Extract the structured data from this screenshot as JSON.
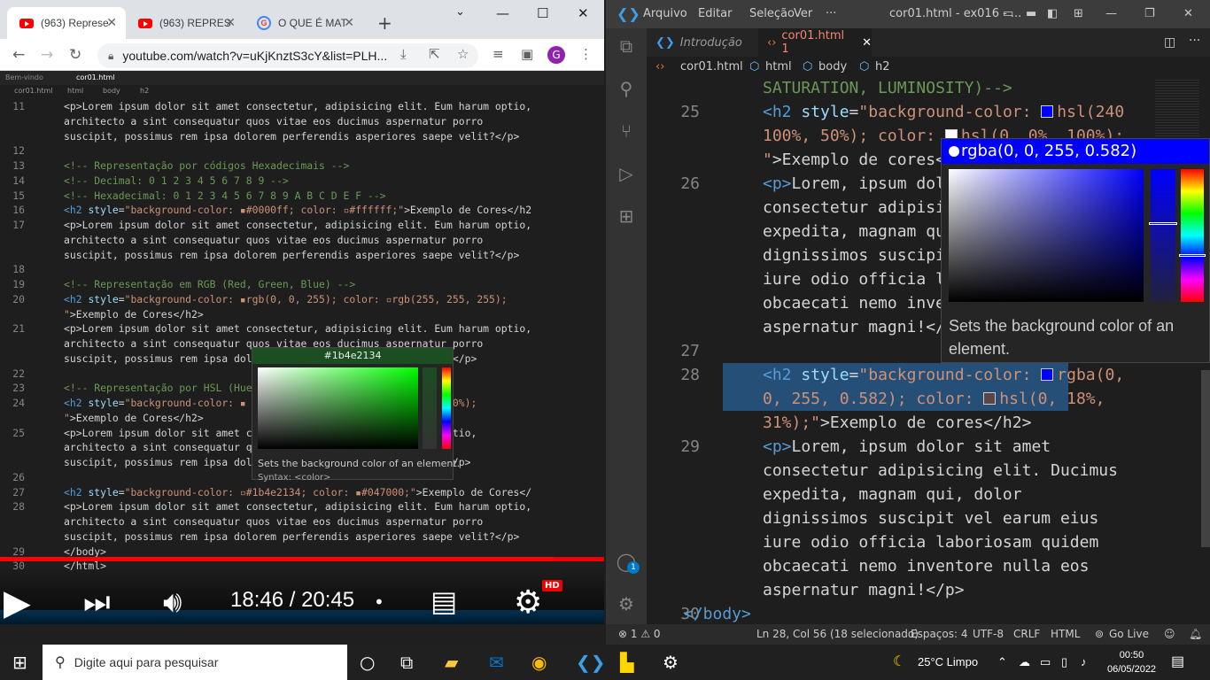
{
  "chrome": {
    "tabs": [
      {
        "label": "(963) Represe",
        "active": true
      },
      {
        "label": "(963) REPRES",
        "active": false
      },
      {
        "label": "O QUE É MAT",
        "active": false
      }
    ],
    "new_tab": "+",
    "url": "youtube.com/watch?v=uKjKnztS3cY&list=PLH...",
    "avatar": "G"
  },
  "video": {
    "inner_tabs": [
      "Bem-vindo",
      "cor01.html"
    ],
    "inner_crumbs": [
      "cor01.html",
      "html",
      "body",
      "h2"
    ],
    "lines": [
      {
        "n": "11",
        "parts": [
          [
            "tx",
            "<p>Lorem ipsum dolor sit amet consectetur, adipisicing elit. Eum harum optio,"
          ]
        ]
      },
      {
        "n": "",
        "parts": [
          [
            "tx",
            "architecto a sint consequatur quos vitae eos ducimus aspernatur porro"
          ]
        ]
      },
      {
        "n": "",
        "parts": [
          [
            "tx",
            "suscipit, possimus rem ipsa dolorem perferendis asperiores saepe velit?</p>"
          ]
        ]
      },
      {
        "n": "12",
        "parts": []
      },
      {
        "n": "13",
        "parts": [
          [
            "cm",
            "<!-- Representação por códigos Hexadecimais -->"
          ]
        ]
      },
      {
        "n": "14",
        "parts": [
          [
            "cm",
            "<!-- Decimal: 0 1 2 3 4 5 6 7 8 9 -->"
          ]
        ]
      },
      {
        "n": "15",
        "parts": [
          [
            "cm",
            "<!-- Hexadecimal: 0 1 2 3 4 5 6 7 8 9 A B C D E F -->"
          ]
        ]
      },
      {
        "n": "16",
        "parts": [
          [
            "tg",
            "<h2 "
          ],
          [
            "at",
            "style"
          ],
          [
            "tx",
            "="
          ],
          [
            "st",
            "\"background-color: ▪#0000ff; color: ▫#ffffff;\""
          ],
          [
            "tx",
            ">Exemplo de Cores</h2"
          ]
        ]
      },
      {
        "n": "17",
        "parts": [
          [
            "tx",
            "<p>Lorem ipsum dolor sit amet consectetur, adipisicing elit. Eum harum optio,"
          ]
        ]
      },
      {
        "n": "",
        "parts": [
          [
            "tx",
            "architecto a sint consequatur quos vitae eos ducimus aspernatur porro"
          ]
        ]
      },
      {
        "n": "",
        "parts": [
          [
            "tx",
            "suscipit, possimus rem ipsa dolorem perferendis asperiores saepe velit?</p>"
          ]
        ]
      },
      {
        "n": "18",
        "parts": []
      },
      {
        "n": "19",
        "parts": [
          [
            "cm",
            "<!-- Representação em RGB (Red, Green, Blue) -->"
          ]
        ]
      },
      {
        "n": "20",
        "parts": [
          [
            "tg",
            "<h2 "
          ],
          [
            "at",
            "style"
          ],
          [
            "tx",
            "="
          ],
          [
            "st",
            "\"background-color: ▪rgb(0, 0, 255); color: ▫rgb(255, 255, 255);"
          ]
        ]
      },
      {
        "n": "",
        "parts": [
          [
            "st",
            "\""
          ],
          [
            "tx",
            ">Exemplo de Cores</h2>"
          ]
        ]
      },
      {
        "n": "21",
        "parts": [
          [
            "tx",
            "<p>Lorem ipsum dolor sit amet consectetur, adipisicing elit. Eum harum optio,"
          ]
        ]
      },
      {
        "n": "",
        "parts": [
          [
            "tx",
            "architecto a sint consequatur quos vitae eos ducimus aspernatur porro"
          ]
        ]
      },
      {
        "n": "",
        "parts": [
          [
            "tx",
            "suscipit, possimus rem ipsa dolo                          velit?</p>"
          ]
        ]
      },
      {
        "n": "22",
        "parts": []
      },
      {
        "n": "23",
        "parts": [
          [
            "cm",
            "<!-- Representação por HSL (Hue"
          ]
        ]
      },
      {
        "n": "24",
        "parts": [
          [
            "tg",
            "<h2 "
          ],
          [
            "at",
            "style"
          ],
          [
            "tx",
            "="
          ],
          [
            "st",
            "\"background-color: ▪                         0, 0%, 100%);"
          ]
        ]
      },
      {
        "n": "",
        "parts": [
          [
            "st",
            "\""
          ],
          [
            "tx",
            ">Exemplo de Cores</h2>"
          ]
        ]
      },
      {
        "n": "25",
        "parts": [
          [
            "tx",
            "<p>Lorem ipsum dolor sit amet c                         harum optio,"
          ]
        ]
      },
      {
        "n": "",
        "parts": [
          [
            "tx",
            "architecto a sint consequatur q                         ur porro"
          ]
        ]
      },
      {
        "n": "",
        "parts": [
          [
            "tx",
            "suscipit, possimus rem ipsa dol                          velit?</p>"
          ]
        ]
      },
      {
        "n": "26",
        "parts": []
      },
      {
        "n": "27",
        "parts": [
          [
            "tg",
            "<h2 "
          ],
          [
            "at",
            "style"
          ],
          [
            "tx",
            "="
          ],
          [
            "st",
            "\"background-color: ▫#1b4e2134; color: ▪#047000;\""
          ],
          [
            "tx",
            ">Exemplo de Cores</"
          ]
        ]
      },
      {
        "n": "28",
        "parts": [
          [
            "tx",
            "<p>Lorem ipsum dolor sit amet consectetur, adipisicing elit. Eum harum optio,"
          ]
        ]
      },
      {
        "n": "",
        "parts": [
          [
            "tx",
            "architecto a sint consequatur quos vitae eos ducimus aspernatur porro"
          ]
        ]
      },
      {
        "n": "",
        "parts": [
          [
            "tx",
            "suscipit, possimus rem ipsa dolorem perferendis asperiores saepe velit?</p>"
          ]
        ]
      },
      {
        "n": "29",
        "parts": [
          [
            "tx",
            "</body>"
          ]
        ]
      },
      {
        "n": "30",
        "parts": [
          [
            "tx",
            "</html>"
          ]
        ]
      }
    ],
    "picker_header": "#1b4e2134",
    "picker_tip": "Sets the background color of an element.",
    "picker_syntax": "Syntax: <color>",
    "time": "18:46 / 20:45",
    "hd_badge": "HD",
    "watched_fraction": 0.917
  },
  "vscode": {
    "menu": [
      "Arquivo",
      "Editar",
      "Seleção",
      "Ver",
      "···"
    ],
    "window_title": "cor01.html - ex016 - ...",
    "tabs": [
      {
        "label": "Introdução",
        "active": false
      },
      {
        "label": "cor01.html 1",
        "active": true
      }
    ],
    "crumbs": [
      "cor01.html",
      "html",
      "body",
      "h2"
    ],
    "picker_header": "rgba(0, 0, 255, 0.582)",
    "picker_tip": "Sets the background color of an element.",
    "status": {
      "problems": "⊗ 1 ⚠ 0",
      "position": "Ln 28, Col 56 (18 selecionado)",
      "spaces": "Espaços: 4",
      "encoding": "UTF-8",
      "eol": "CRLF",
      "language": "HTML",
      "live": "Go Live"
    },
    "accounts_badge": "1"
  },
  "taskbar": {
    "search_placeholder": "Digite aqui para pesquisar",
    "weather": "25°C  Limpo",
    "time": "00:50",
    "date": "06/05/2022"
  },
  "colors": {
    "accent_blue": "#007acc",
    "youtube_red": "#ff0000",
    "picker_blue": "#0000ff",
    "picker_green": "#1b4e21"
  }
}
